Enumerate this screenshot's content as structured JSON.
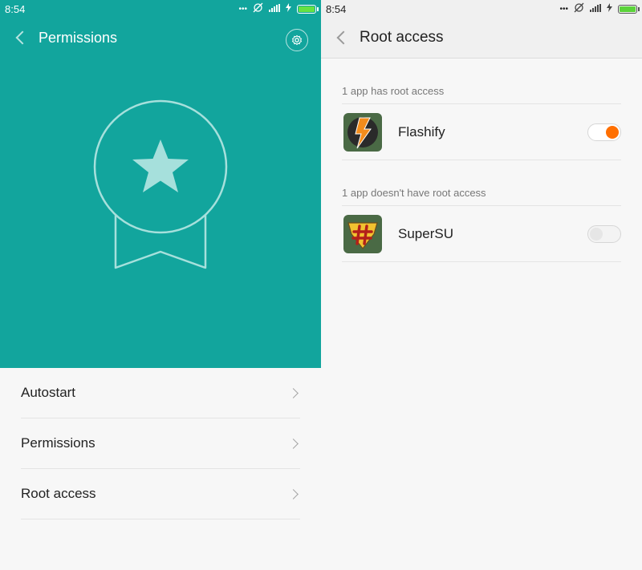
{
  "colors": {
    "teal_header": "#12a59d",
    "badge_fill": "#a6e0dc",
    "toggle_on": "#ff6f00",
    "battery_green": "#66e243"
  },
  "left": {
    "status": {
      "time": "8:54",
      "icons": [
        "more-icon",
        "sync-off-icon",
        "signal-icon",
        "charging-icon",
        "battery-icon"
      ]
    },
    "header": {
      "title": "Permissions",
      "back_icon": "back-chevron-icon",
      "settings_icon": "gear-icon"
    },
    "hero_icon": "badge-star-icon",
    "menu": [
      {
        "label": "Autostart"
      },
      {
        "label": "Permissions"
      },
      {
        "label": "Root access"
      }
    ]
  },
  "right": {
    "status": {
      "time": "8:54",
      "icons": [
        "more-icon",
        "sync-off-icon",
        "signal-icon",
        "charging-icon",
        "battery-icon"
      ]
    },
    "header": {
      "title": "Root access",
      "back_icon": "back-chevron-icon"
    },
    "sections": [
      {
        "label": "1 app has root access",
        "apps": [
          {
            "name": "Flashify",
            "icon": "flashify-icon",
            "enabled": true
          }
        ]
      },
      {
        "label": "1 app doesn't have root access",
        "apps": [
          {
            "name": "SuperSU",
            "icon": "supersu-icon",
            "enabled": false
          }
        ]
      }
    ]
  }
}
